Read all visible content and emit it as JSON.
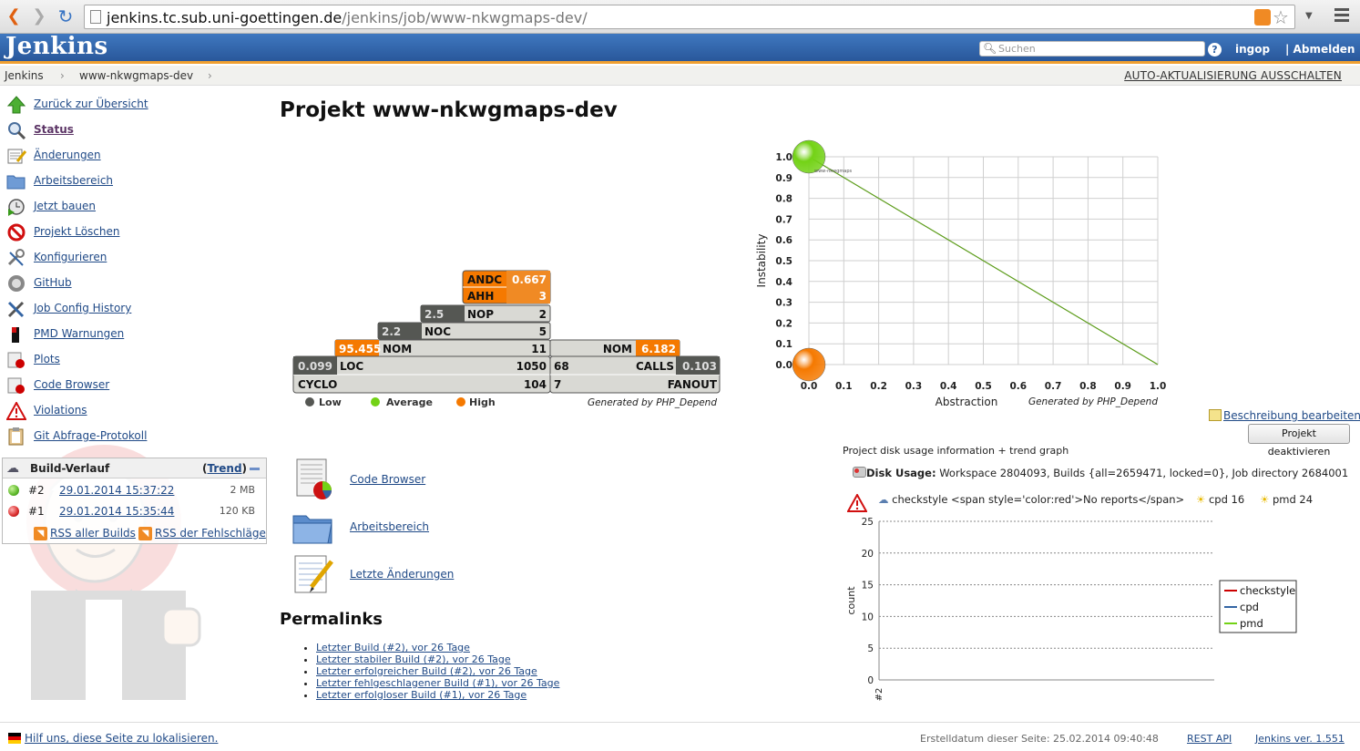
{
  "browser": {
    "url_host": "jenkins.tc.sub.uni-goettingen.de",
    "url_path": "/jenkins/job/www-nkwgmaps-dev/"
  },
  "header": {
    "logo": "Jenkins",
    "search_placeholder": "Suchen",
    "help": "?",
    "user": "ingop",
    "logout": "| Abmelden"
  },
  "breadcrumb": {
    "items": [
      "Jenkins",
      "www-nkwgmaps-dev"
    ],
    "sep": "›",
    "autorefresh": "AUTO-AKTUALISIERUNG AUSSCHALTEN"
  },
  "tasks": [
    {
      "label": "Zurück zur Übersicht",
      "icon": "up-arrow-icon"
    },
    {
      "label": "Status",
      "icon": "magnifier-icon"
    },
    {
      "label": "Änderungen",
      "icon": "notepad-icon"
    },
    {
      "label": "Arbeitsbereich",
      "icon": "folder-icon"
    },
    {
      "label": "Jetzt bauen",
      "icon": "clock-play-icon"
    },
    {
      "label": "Projekt Löschen",
      "icon": "no-entry-icon"
    },
    {
      "label": "Konfigurieren",
      "icon": "wrench-icon"
    },
    {
      "label": "GitHub",
      "icon": "github-icon"
    },
    {
      "label": "Job Config History",
      "icon": "tools-icon"
    },
    {
      "label": "PMD Warnungen",
      "icon": "pmd-icon"
    },
    {
      "label": "Plots",
      "icon": "plot-icon"
    },
    {
      "label": "Code Browser",
      "icon": "code-browser-icon"
    },
    {
      "label": "Violations",
      "icon": "warning-icon"
    },
    {
      "label": "Git Abfrage-Protokoll",
      "icon": "clipboard-icon"
    }
  ],
  "build_history": {
    "title": "Build-Verlauf",
    "trend_open": "(",
    "trend_link": "Trend",
    "trend_close": ")",
    "builds": [
      {
        "num": "#2",
        "date": "29.01.2014 15:37:22",
        "size": "2 MB",
        "status_color": "#5db82a"
      },
      {
        "num": "#1",
        "date": "29.01.2014 15:35:44",
        "size": "120 KB",
        "status_color": "#d92b2b"
      }
    ],
    "rss_all": "RSS aller Builds",
    "rss_failed": "RSS der Fehlschläge"
  },
  "main": {
    "title": "Projekt www-nkwgmaps-dev",
    "edit_description": "Beschreibung bearbeiten",
    "deactivate": "Projekt deaktivieren",
    "links": [
      {
        "label": "Code Browser",
        "icon": "code-browser-icon"
      },
      {
        "label": "Arbeitsbereich",
        "icon": "folder-icon"
      },
      {
        "label": "Letzte Änderungen",
        "icon": "notepad-icon"
      }
    ],
    "permalinks_title": "Permalinks",
    "permalinks": [
      "Letzter Build (#2), vor 26 Tage",
      "Letzter stabiler Build (#2), vor 26 Tage",
      "Letzter erfolgreicher Build (#2), vor 26 Tage",
      "Letzter fehlgeschlagener Build (#1), vor 26 Tage",
      "Letzter erfolgloser Build (#1), vor 26 Tage"
    ]
  },
  "pyramid": {
    "rows": {
      "andc": {
        "label": "ANDC",
        "value": "0.667"
      },
      "ahh": {
        "label": "AHH",
        "value": "3"
      },
      "nop": {
        "label": "NOP",
        "value": "2",
        "ratio": "2.5"
      },
      "noc": {
        "label": "NOC",
        "value": "5",
        "ratio": "2.2"
      },
      "nom_left": {
        "label": "NOM",
        "value": "11",
        "ratio": "95.455"
      },
      "loc": {
        "label": "LOC",
        "value": "1050",
        "ratio": "0.099"
      },
      "cyclo": {
        "label": "CYCLO",
        "value": "104"
      },
      "nom_right": {
        "label": "NOM",
        "ratio": "6.182"
      },
      "calls": {
        "label": "CALLS",
        "value": "68",
        "ratio": "0.103"
      },
      "fanout": {
        "label": "FANOUT",
        "value": "7"
      }
    },
    "legend": [
      "Low",
      "Average",
      "High"
    ],
    "generated": "Generated by PHP_Depend",
    "colors": {
      "low": "#555753",
      "average": "#73d216",
      "high": "#f57900"
    }
  },
  "disk": {
    "title": "Project disk usage information + trend graph",
    "label": "Disk Usage:",
    "text": "Workspace 2804093, Builds {all=2659471, locked=0}, Job directory 2684001"
  },
  "warnings": {
    "checkstyle": "checkstyle <span style='color:red'>No reports</span>",
    "cpd": "cpd 16",
    "pmd": "pmd 24"
  },
  "footer": {
    "localize": "Hilf uns, diese Seite zu lokalisieren.",
    "generated": "Erstelldatum dieser Seite: 25.02.2014 09:40:48",
    "rest": "REST API",
    "version": "Jenkins ver. 1.551"
  },
  "chart_data": [
    {
      "type": "scatter",
      "xlabel": "Abstraction",
      "ylabel": "Instability",
      "xlim": [
        0.0,
        1.0
      ],
      "ylim": [
        0.0,
        1.0
      ],
      "ticks": [
        "0.0",
        "0.1",
        "0.2",
        "0.3",
        "0.4",
        "0.5",
        "0.6",
        "0.7",
        "0.8",
        "0.9",
        "1.0"
      ],
      "grid": true,
      "main_sequence": [
        [
          0.0,
          1.0
        ],
        [
          1.0,
          0.0
        ]
      ],
      "points": [
        {
          "x": 0.0,
          "y": 1.0,
          "color": "#73d216",
          "label": "www-nkwgmaps"
        },
        {
          "x": 0.0,
          "y": 0.0,
          "color": "#f57900"
        }
      ],
      "generated": "Generated by PHP_Depend"
    },
    {
      "type": "line",
      "ylabel": "count",
      "categories": [
        "#2"
      ],
      "ylim": [
        0,
        25
      ],
      "yticks": [
        0,
        5,
        10,
        15,
        20,
        25
      ],
      "grid": true,
      "legend_position": "right",
      "series": [
        {
          "name": "checkstyle",
          "values": [
            0
          ],
          "color": "#cc0000"
        },
        {
          "name": "cpd",
          "values": [
            0
          ],
          "color": "#3465a4"
        },
        {
          "name": "pmd",
          "values": [
            0
          ],
          "color": "#73d216"
        }
      ]
    }
  ]
}
